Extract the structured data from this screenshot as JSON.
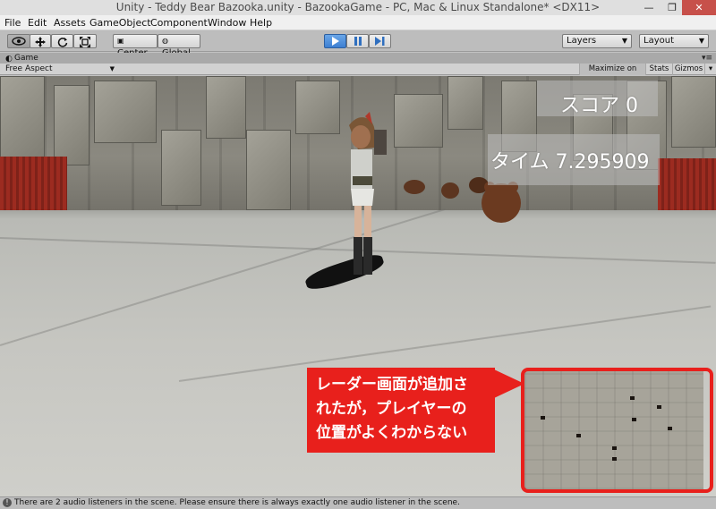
{
  "window": {
    "title": "Unity - Teddy Bear Bazooka.unity - BazookaGame - PC, Mac & Linux Standalone* <DX11>",
    "minimize_glyph": "—",
    "maximize_glyph": "❐",
    "close_glyph": "✕"
  },
  "menu": [
    "File",
    "Edit",
    "Assets",
    "GameObject",
    "Component",
    "Window",
    "Help"
  ],
  "toolbar": {
    "tools": [
      {
        "name": "view-tool",
        "icon": "eye-icon"
      },
      {
        "name": "move-tool",
        "icon": "move-arrows-icon"
      },
      {
        "name": "rotate-tool",
        "icon": "rotate-icon"
      },
      {
        "name": "scale-tool",
        "icon": "scale-icon"
      }
    ],
    "pivot_label": "Center",
    "space_label": "Global",
    "play_controls": [
      {
        "name": "play",
        "icon": "play-icon"
      },
      {
        "name": "pause",
        "icon": "pause-icon"
      },
      {
        "name": "step",
        "icon": "step-icon"
      }
    ],
    "layers_label": "Layers",
    "layout_label": "Layout"
  },
  "panel": {
    "tab_label": "Game",
    "aspect_label": "Free Aspect",
    "maximize_label": "Maximize on Play",
    "stats_label": "Stats",
    "gizmos_label": "Gizmos"
  },
  "hud": {
    "score": "スコア 0",
    "time": "タイム 7.295909"
  },
  "annotation": {
    "line1": "レーダー画面が追加さ",
    "line2": "れたが，プレイヤーの",
    "line3": "位置がよくわからない",
    "color": "#e8201c"
  },
  "status": {
    "message": "There are 2 audio listeners in the scene. Please ensure there is always exactly one audio listener in the scene."
  },
  "colors": {
    "accent_blue": "#3d7fd2",
    "annotation_red": "#e8201c",
    "close_button": "#c7504a"
  }
}
